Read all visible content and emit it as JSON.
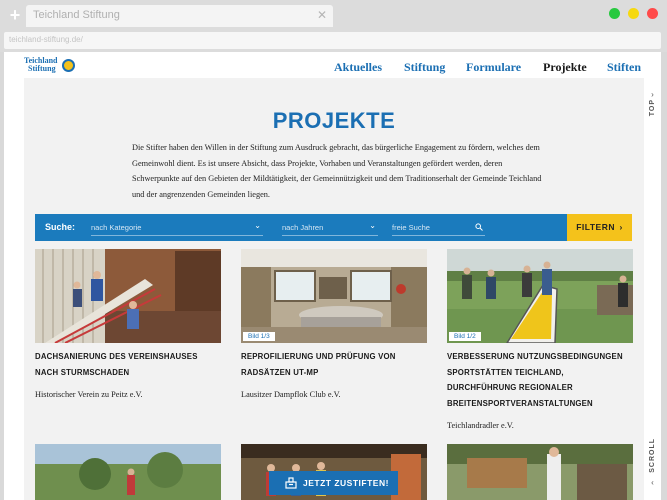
{
  "browser": {
    "tab_title": "Teichland Stiftung",
    "address": "teichland-stiftung.de/"
  },
  "logo": {
    "line1": "Teichland",
    "line2": "Stiftung"
  },
  "nav": [
    {
      "label": "Aktuelles"
    },
    {
      "label": "Stiftung"
    },
    {
      "label": "Formulare"
    },
    {
      "label": "Projekte",
      "active": true
    },
    {
      "label": "Stiften"
    }
  ],
  "rail": {
    "top": "TOP",
    "scroll": "SCROLL"
  },
  "page": {
    "title": "PROJEKTE",
    "intro": "Die Stifter haben den Willen in der Stiftung zum Ausdruck gebracht, das bürgerliche Engagement zu fördern, welches dem Gemeinwohl dient. Es ist unsere Absicht, dass Projekte, Vorhaben und Veranstaltungen gefördert werden, deren Schwerpunkte auf den Gebieten der Mildtätigkeit, der Gemeinnützigkeit und dem Traditionserhalt der Gemeinde Teichland und der angrenzenden Gemeinden liegen."
  },
  "search": {
    "label": "Suche:",
    "category_placeholder": "nach Kategorie",
    "year_placeholder": "nach Jahren",
    "free_placeholder": "freie Suche",
    "filter_label": "FILTERN"
  },
  "cards": [
    {
      "title": "DACHSANIERUNG DES VEREINSHAUSES NACH STURMSCHADEN",
      "org": "Historischer Verein zu Peitz e.V.",
      "badge": ""
    },
    {
      "title": "REPROFILIERUNG UND PRÜFUNG VON RADSÄTZEN UT-MP",
      "org": "Lausitzer Dampflok Club e.V.",
      "badge": "Bild 1/3"
    },
    {
      "title": "VERBESSERUNG NUTZUNGSBEDINGUNGEN SPORTSTÄTTEN TEICHLAND, DURCHFÜHRUNG REGIONALER BREITENSPORTVERANSTALTUNGEN",
      "org": "Teichlandradler e.V.",
      "badge": "Bild 1/2"
    }
  ],
  "cta": {
    "label": "JETZT ZUSTIFTEN!"
  },
  "colors": {
    "brand_blue": "#1b6fb3",
    "accent_yellow": "#f4c21b",
    "search_blue": "#1b7bbd"
  }
}
